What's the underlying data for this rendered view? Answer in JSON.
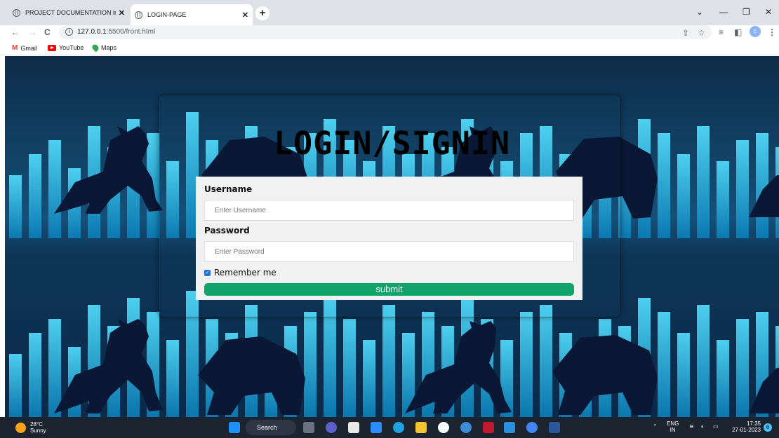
{
  "browser": {
    "tabs": [
      {
        "title": "PROJECT DOCUMENTATION in p",
        "close": "✕"
      },
      {
        "title": "LOGIN-PAGE",
        "close": "✕"
      }
    ],
    "new_tab": "+",
    "url_host": "127.0.0.1",
    "url_rest": ":5500/front.html",
    "profile_initial": "c",
    "bookmarks": [
      {
        "label": "Gmail",
        "icon": "gmail-icon"
      },
      {
        "label": "YouTube",
        "icon": "youtube-icon"
      },
      {
        "label": "Maps",
        "icon": "maps-icon"
      }
    ]
  },
  "page": {
    "heading": "LOGIN/SIGNIN",
    "username_label": "Username",
    "username_placeholder": "Enter Username",
    "password_label": "Password",
    "password_placeholder": "Enter Password",
    "remember_label": "Remember me",
    "remember_checked": true,
    "submit_label": "submit"
  },
  "taskbar": {
    "temperature": "28°C",
    "weather": "Sunny",
    "search_label": "Search",
    "lang_top": "ENG",
    "lang_bottom": "IN",
    "time": "17:35",
    "date": "27-01-2023",
    "notification_count": "6"
  },
  "colors": {
    "submit": "#10a36a",
    "background_bars": "#19c3ef",
    "silhouettes": "#0a1836"
  }
}
